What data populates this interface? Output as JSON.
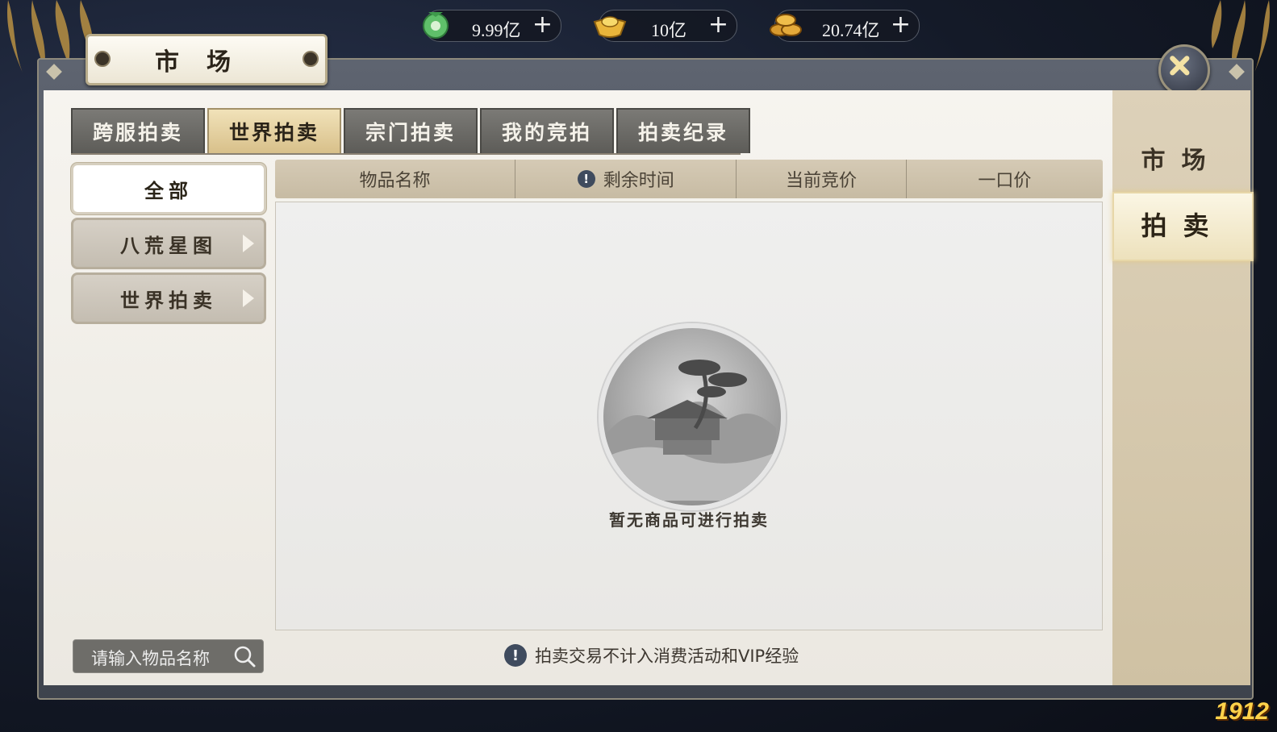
{
  "currencies": [
    {
      "icon": "jade-coin-icon",
      "value": "9.99亿"
    },
    {
      "icon": "gold-ingot-icon",
      "value": "10亿"
    },
    {
      "icon": "copper-coins-icon",
      "value": "20.74亿"
    }
  ],
  "window": {
    "title": "市场"
  },
  "tabs": [
    "跨服拍卖",
    "世界拍卖",
    "宗门拍卖",
    "我的竞拍",
    "拍卖纪录"
  ],
  "active_tab": "世界拍卖",
  "categories": [
    {
      "label": "全部",
      "active": true
    },
    {
      "label": "八荒星图",
      "active": false
    },
    {
      "label": "世界拍卖",
      "active": false
    }
  ],
  "table": {
    "columns": [
      "物品名称",
      "剩余时间",
      "当前竞价",
      "一口价"
    ],
    "empty_text": "暂无商品可进行拍卖"
  },
  "search": {
    "placeholder": "请输入物品名称"
  },
  "notice": "拍卖交易不计入消费活动和VIP经验",
  "side_tabs": [
    {
      "label": "市场",
      "active": false
    },
    {
      "label": "拍卖",
      "active": true
    }
  ],
  "watermark": "1912",
  "colors": {
    "active_tab": "#e6d3a2",
    "panel": "#f3f1ec",
    "frame": "#4d525c"
  }
}
